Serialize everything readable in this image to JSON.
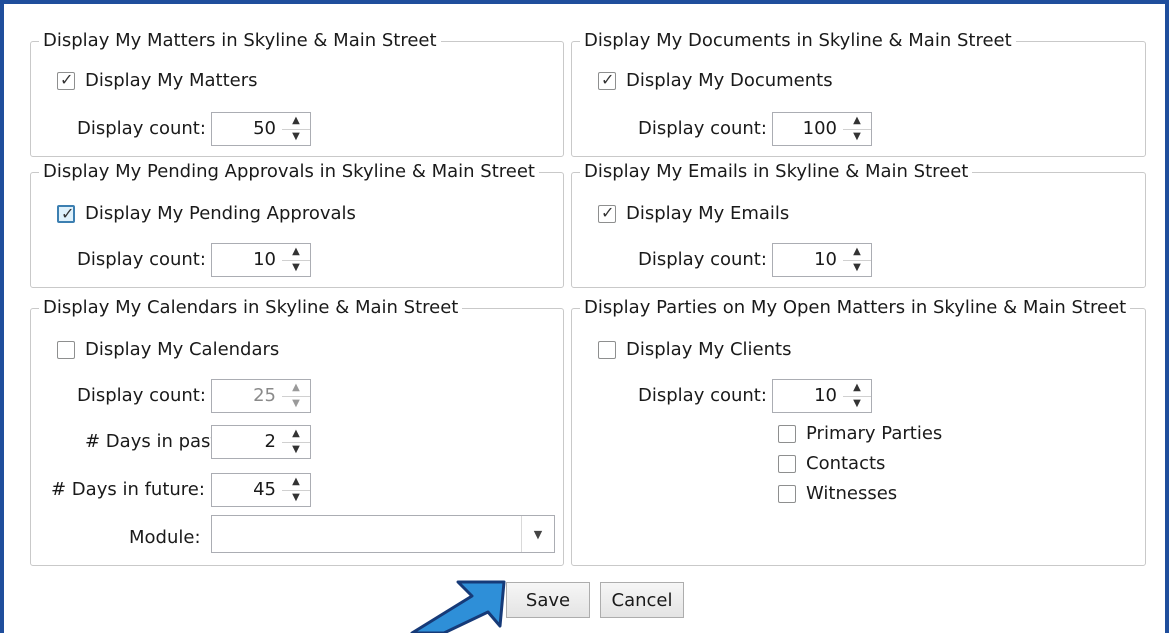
{
  "groups": {
    "matters": {
      "title": "Display My Matters in Skyline & Main Street",
      "check_label": "Display My Matters",
      "checked": true,
      "count_label": "Display count:",
      "count": "50"
    },
    "documents": {
      "title": "Display My Documents in Skyline & Main Street",
      "check_label": "Display My Documents",
      "checked": true,
      "count_label": "Display count:",
      "count": "100"
    },
    "approvals": {
      "title": "Display My Pending Approvals in Skyline & Main Street",
      "check_label": "Display My Pending Approvals",
      "checked": true,
      "count_label": "Display count:",
      "count": "10"
    },
    "emails": {
      "title": "Display My Emails in Skyline & Main Street",
      "check_label": "Display My Emails",
      "checked": true,
      "count_label": "Display count:",
      "count": "10"
    },
    "calendars": {
      "title": "Display My Calendars in Skyline & Main Street",
      "check_label": "Display My Calendars",
      "checked": false,
      "count_label": "Display count:",
      "count": "25",
      "past_label": "# Days in past:",
      "past": "2",
      "future_label": "# Days in future:",
      "future": "45",
      "module_label": "Module:",
      "module": ""
    },
    "parties": {
      "title": "Display Parties on My Open Matters in Skyline & Main Street",
      "check_label": "Display My Clients",
      "checked": false,
      "count_label": "Display count:",
      "count": "10",
      "options": [
        "Primary Parties",
        "Contacts",
        "Witnesses"
      ]
    }
  },
  "buttons": {
    "save": "Save",
    "cancel": "Cancel"
  },
  "colors": {
    "frame": "#1f4e9c",
    "arrow": "#2e8fd8"
  }
}
